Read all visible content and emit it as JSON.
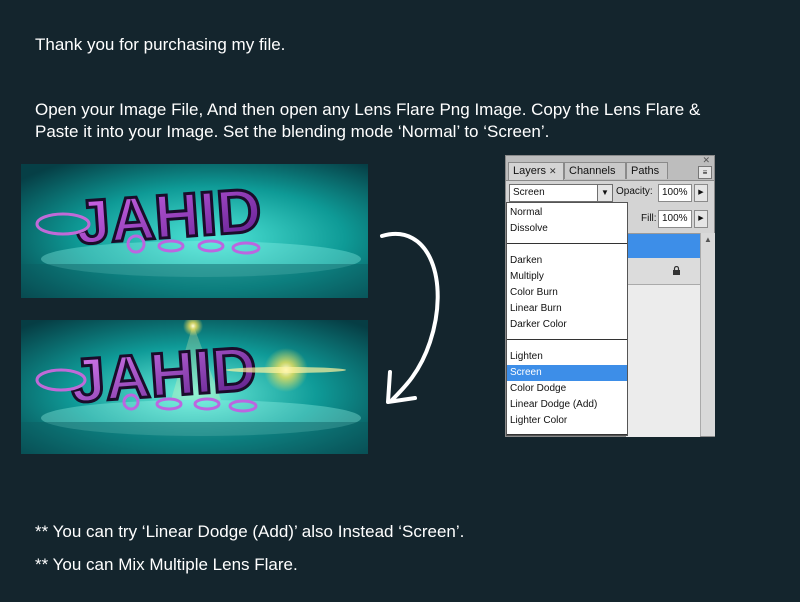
{
  "intro": {
    "thanks": "Thank you for purchasing my file.",
    "instruction_line1": "Open your Image File, And then open any Lens Flare Png Image. Copy the Lens Flare &",
    "instruction_line2": "Paste it into your Image. Set the blending mode ‘Normal’ to ‘Screen’."
  },
  "artwork": {
    "word": "JAHID",
    "before_label": "",
    "after_label": ""
  },
  "layers_panel": {
    "tabs": [
      {
        "label": "Layers",
        "active": true
      },
      {
        "label": "Channels",
        "active": false
      },
      {
        "label": "Paths",
        "active": false
      }
    ],
    "blend_mode_value": "Screen",
    "opacity_label": "Opacity:",
    "opacity_value": "100%",
    "fill_label": "Fill:",
    "fill_value": "100%",
    "blend_options": [
      "Normal",
      "Dissolve",
      "Darken",
      "Multiply",
      "Color Burn",
      "Linear Burn",
      "Darker Color",
      "Lighten",
      "Screen",
      "Color Dodge",
      "Linear Dodge (Add)",
      "Lighter Color"
    ],
    "selected_option": "Screen"
  },
  "tips": {
    "tip1": "** You can try ‘Linear Dodge (Add)’ also Instead ‘Screen’.",
    "tip2": "** You can Mix Multiple Lens Flare."
  },
  "colors": {
    "background": "#14252d",
    "selection": "#3d8ee8",
    "art_teal": "#1fb5b0",
    "art_magenta": "#c438d8"
  }
}
